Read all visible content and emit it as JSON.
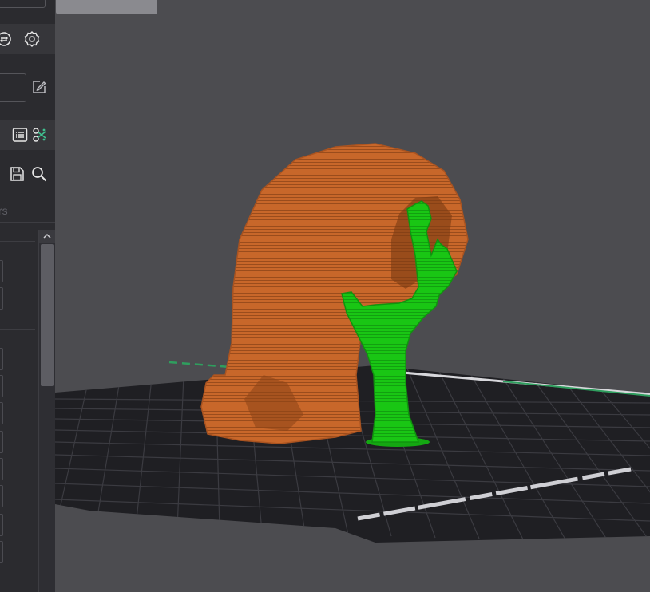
{
  "side_panel": {
    "section_label_partial": "rs",
    "icons": [
      "spool-refresh-icon",
      "settings-gear-icon",
      "edit-icon",
      "list-icon",
      "scissors-icon",
      "save-icon",
      "search-icon"
    ]
  },
  "viewport": {
    "objects": [
      {
        "name": "orange-curved-model",
        "color": "#c8672a"
      },
      {
        "name": "green-hand-model",
        "color": "#19c614"
      }
    ],
    "colors": {
      "background": "#4c4c50",
      "bed": "#1e1e22",
      "grid": "#3c3c42",
      "accent_green": "#2f9e5e"
    }
  }
}
